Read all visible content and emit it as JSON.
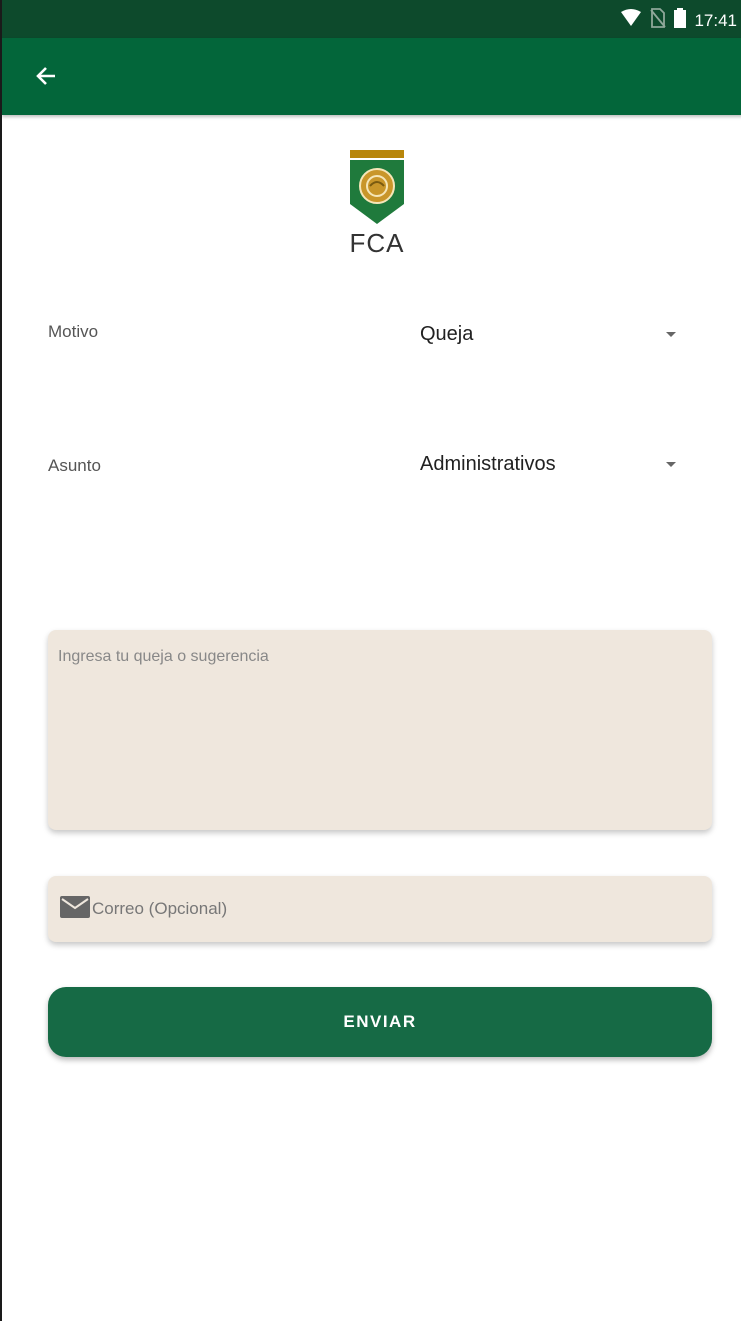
{
  "status_bar": {
    "time": "17:41",
    "icons": [
      "wifi-icon",
      "no-sim-icon",
      "battery-icon"
    ]
  },
  "app_bar": {
    "back_icon": "arrow-back-icon"
  },
  "logo": {
    "text": "FCA"
  },
  "form": {
    "motivo": {
      "label": "Motivo",
      "selected": "Queja"
    },
    "asunto": {
      "label": "Asunto",
      "selected": "Administrativos"
    },
    "message": {
      "placeholder": "Ingresa tu queja o sugerencia",
      "value": ""
    },
    "email": {
      "placeholder": "Correo (Opcional)",
      "value": "",
      "icon": "mail-icon"
    },
    "submit_label": "ENVIAR"
  },
  "colors": {
    "status_bar": "#0d4a2c",
    "app_bar": "#03663a",
    "button": "#166a45",
    "field_background": "#efe7dd",
    "logo_gold": "#b8860b",
    "logo_green": "#1f7a3c"
  }
}
